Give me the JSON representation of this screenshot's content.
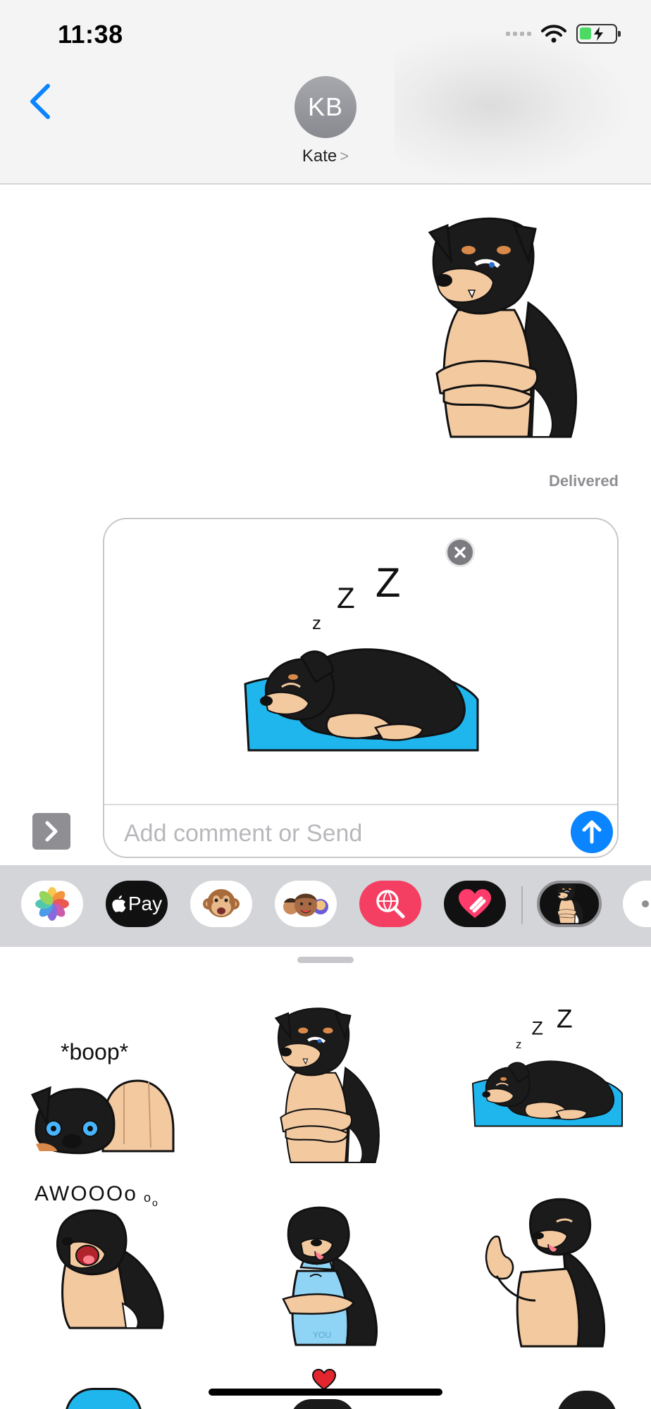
{
  "status_bar": {
    "time": "11:38"
  },
  "header": {
    "back_icon": "chevron-left-icon",
    "avatar_initials": "KB",
    "contact_name": "Kate",
    "contact_chevron": ">"
  },
  "conversation": {
    "sent_sticker": "dog-crossed-arms-sticker",
    "status": "Delivered"
  },
  "compose": {
    "attached_sticker": "dog-sleeping-sticker",
    "zzz": "z Z Z",
    "placeholder": "Add comment or Send"
  },
  "app_strip": {
    "apps": [
      {
        "name": "Photos",
        "icon": "photos-icon"
      },
      {
        "name": "Apple Pay",
        "icon": "apple-pay-icon",
        "label": "Pay"
      },
      {
        "name": "Animoji",
        "icon": "monkey-icon"
      },
      {
        "name": "Memoji",
        "icon": "memoji-icon"
      },
      {
        "name": "Search Images",
        "icon": "globe-search-icon"
      },
      {
        "name": "Digital Touch",
        "icon": "heart-icon"
      },
      {
        "name": "Dog Stickers",
        "icon": "dog-sticker-app-icon"
      },
      {
        "name": "More",
        "icon": "more-icon"
      }
    ]
  },
  "sticker_drawer": {
    "stickers": [
      {
        "name": "boop",
        "caption": "*boop*"
      },
      {
        "name": "crossed-arms",
        "caption": ""
      },
      {
        "name": "sleeping",
        "caption": "z Z Z"
      },
      {
        "name": "awoo",
        "caption": "AWOOOOooo"
      },
      {
        "name": "hug",
        "caption": "YOU"
      },
      {
        "name": "thumbs-up",
        "caption": ""
      }
    ]
  },
  "colors": {
    "accent": "#0a84ff",
    "fur_black": "#1b1b1b",
    "fur_tan": "#f3c9a0",
    "bed_blue": "#1fb6ee",
    "cheek_orange": "#d98a4a"
  }
}
